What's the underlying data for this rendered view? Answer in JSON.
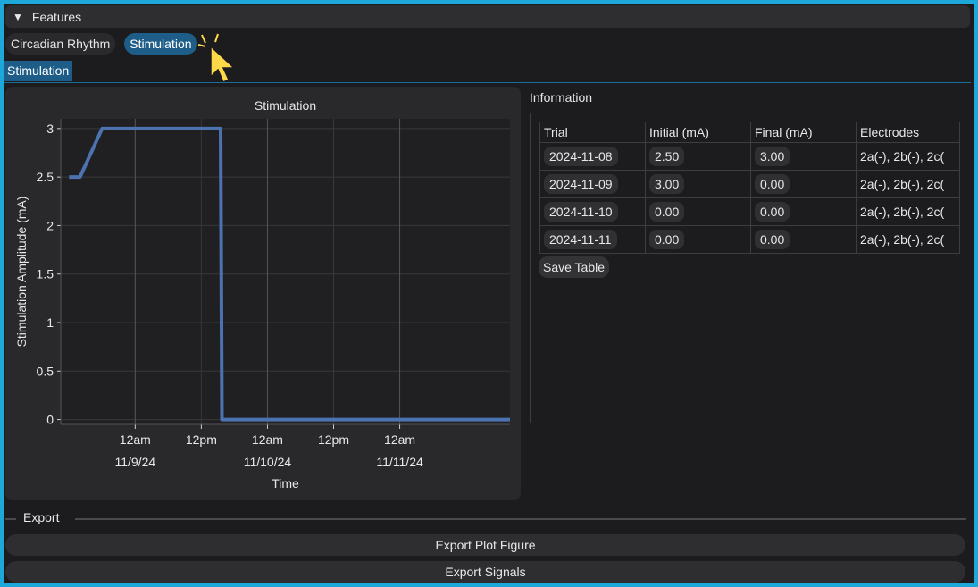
{
  "features": {
    "title": "Features"
  },
  "tabs": [
    {
      "label": "Circadian Rhythm"
    },
    {
      "label": "Stimulation"
    }
  ],
  "subtab": {
    "label": "Stimulation"
  },
  "chart_data": {
    "type": "line",
    "title": "Stimulation",
    "xlabel": "Time",
    "ylabel": "Stimulation Amplitude (mA)",
    "ylim": [
      -0.05,
      3.1
    ],
    "y_ticks": [
      "0",
      "0.5",
      "1",
      "1.5",
      "2",
      "2.5",
      "3"
    ],
    "x_ticks": [
      {
        "label": "12am",
        "sublabel": "11/9/24"
      },
      {
        "label": "12pm",
        "sublabel": ""
      },
      {
        "label": "12am",
        "sublabel": "11/10/24"
      },
      {
        "label": "12pm",
        "sublabel": ""
      },
      {
        "label": "12am",
        "sublabel": "11/11/24"
      }
    ],
    "grid": true,
    "color": "#4c72b0",
    "series": [
      {
        "x": [
          "2024-11-08 12:00",
          "2024-11-08 14:00",
          "2024-11-08 18:00",
          "2024-11-09 15:30",
          "2024-11-09 15:45",
          "2024-11-11 20:00"
        ],
        "values": [
          2.5,
          2.5,
          3.0,
          3.0,
          0.0,
          0.0
        ]
      }
    ]
  },
  "info": {
    "title": "Information",
    "columns": [
      "Trial",
      "Initial (mA)",
      "Final (mA)",
      "Electrodes"
    ],
    "rows": [
      [
        "2024-11-08",
        "2.50",
        "3.00",
        "2a(-), 2b(-), 2c("
      ],
      [
        "2024-11-09",
        "3.00",
        "0.00",
        "2a(-), 2b(-), 2c("
      ],
      [
        "2024-11-10",
        "0.00",
        "0.00",
        "2a(-), 2b(-), 2c("
      ],
      [
        "2024-11-11",
        "0.00",
        "0.00",
        "2a(-), 2b(-), 2c("
      ]
    ],
    "save_label": "Save Table"
  },
  "export": {
    "title": "Export",
    "plot_button": "Export Plot Figure",
    "signals_button": "Export Signals"
  },
  "colors": {
    "accent": "#1d5d88",
    "frame": "#1ea7d9",
    "cursor": "#ffd84a"
  }
}
